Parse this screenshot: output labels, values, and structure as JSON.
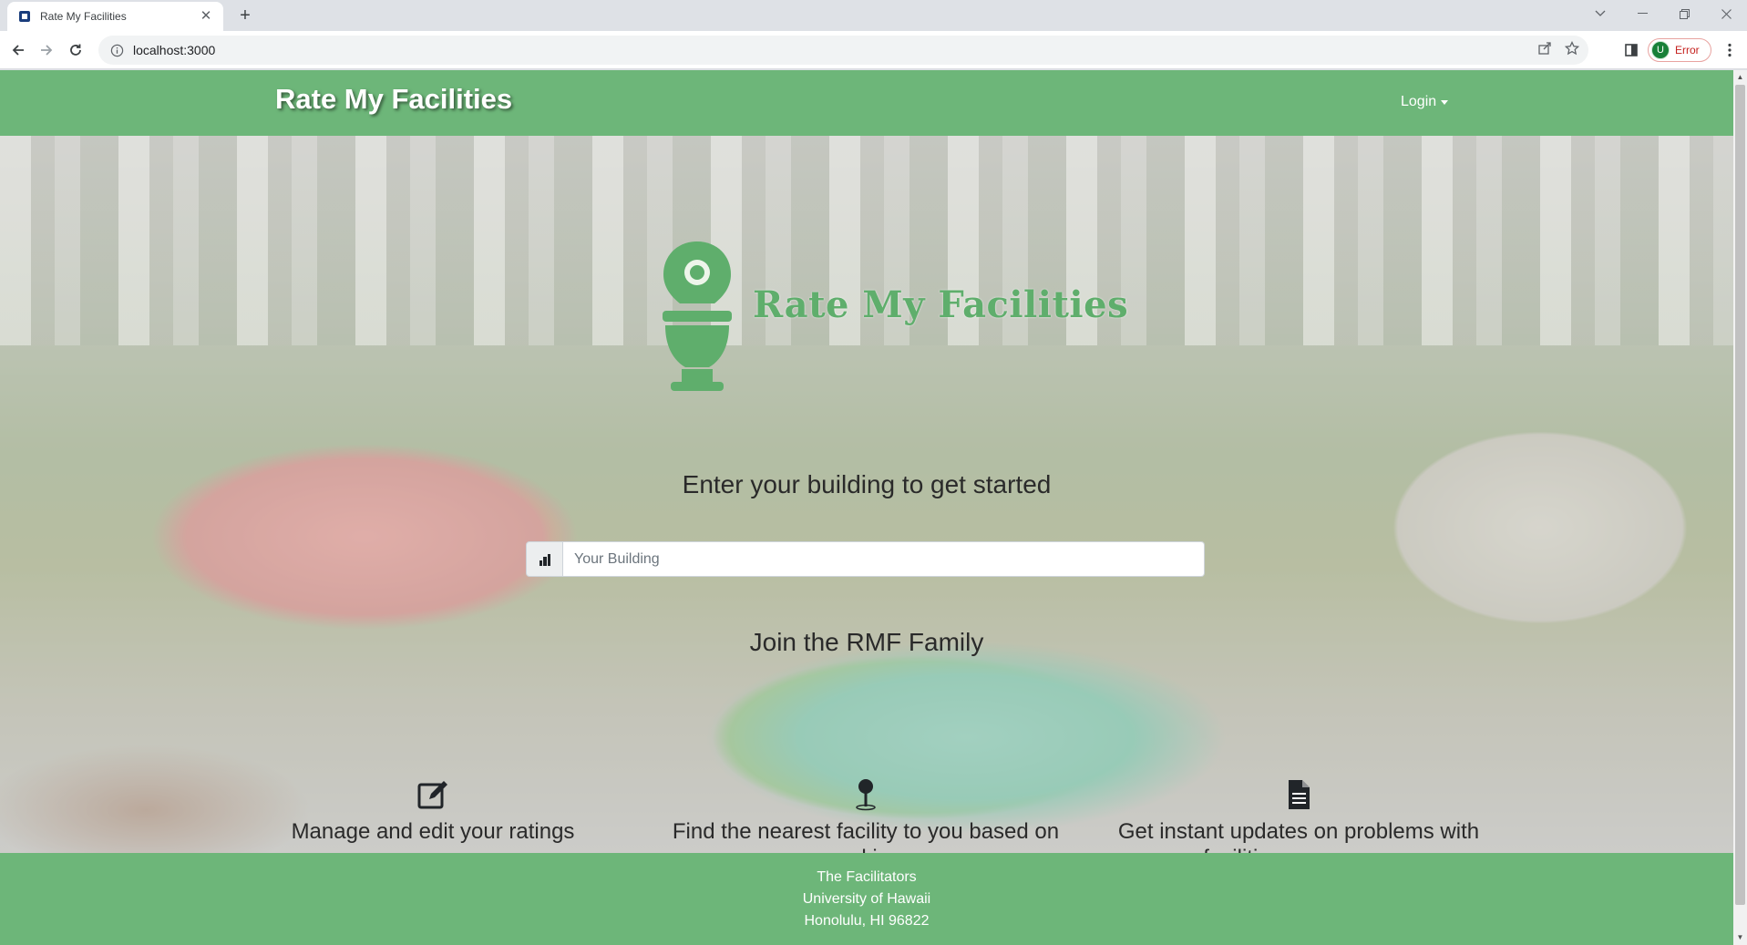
{
  "browser": {
    "tab_title": "Rate My Facilities",
    "new_tab_symbol": "+",
    "url": "localhost:3000",
    "profile_initial": "U",
    "profile_status": "Error"
  },
  "navbar": {
    "brand": "Rate My Facilities",
    "login_label": "Login"
  },
  "hero": {
    "logo_text": "Rate My Facilities",
    "prompt": "Enter your building to get started",
    "search_placeholder": "Your Building",
    "join_heading": "Join the RMF Family",
    "features": [
      {
        "icon": "edit-icon",
        "text": "Manage and edit your ratings"
      },
      {
        "icon": "map-pin-icon",
        "text": "Find the nearest facility to you based on ranking"
      },
      {
        "icon": "document-icon",
        "text": "Get instant updates on problems with facilities on campus"
      }
    ]
  },
  "footer": {
    "line1": "The Facilitators",
    "line2": "University of Hawaii",
    "line3": "Honolulu, HI 96822"
  },
  "colors": {
    "brand_green": "#6db679",
    "logo_green": "#5fae6c"
  }
}
